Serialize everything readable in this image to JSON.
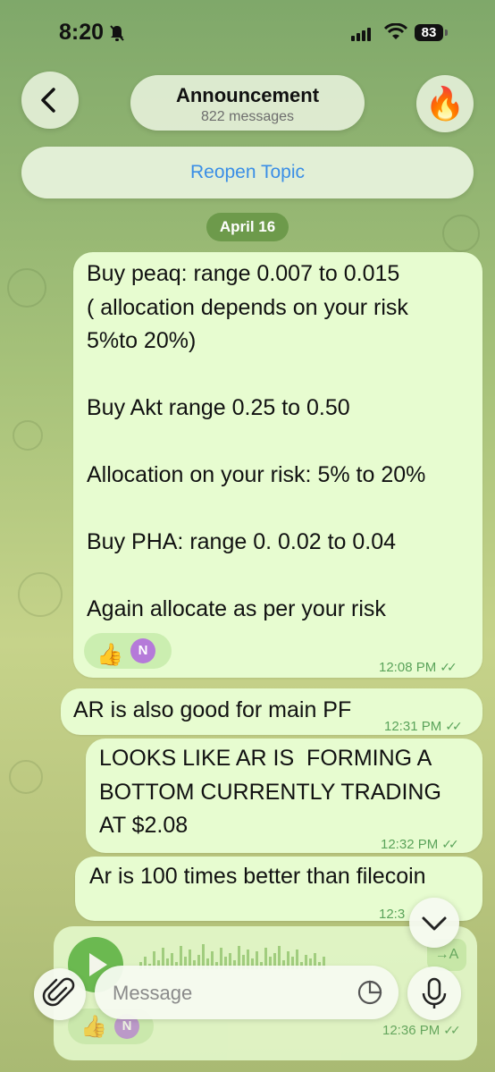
{
  "status_bar": {
    "time": "8:20",
    "battery": "83"
  },
  "header": {
    "title": "Announcement",
    "subtitle": "822 messages",
    "avatar_emoji": "🔥",
    "reopen_label": "Reopen Topic"
  },
  "date_chip": "April 16",
  "messages": [
    {
      "text": "Buy peaq: range 0.007 to 0.015\n( allocation depends on your risk\n5%to 20%)\n\nBuy Akt range 0.25 to 0.50\n\nAllocation on your risk: 5% to 20%\n\nBuy PHA: range 0. 0.02 to 0.04\n\nAgain allocate as per your risk",
      "time": "12:08 PM",
      "reaction_emoji": "👍",
      "reaction_avatar": "N"
    },
    {
      "text": "AR is also good for main PF",
      "time": "12:31 PM"
    },
    {
      "text": "LOOKS LIKE AR IS  FORMING A\nBOTTOM CURRENTLY TRADING\nAT $2.08",
      "time": "12:32 PM"
    },
    {
      "text": "Ar is 100 times better than filecoin",
      "time": "12:3"
    },
    {
      "voice": true,
      "transcribe_label": "→A",
      "time": "12:36 PM",
      "reaction_emoji": "👍",
      "reaction_avatar": "N"
    }
  ],
  "composer": {
    "placeholder": "Message"
  },
  "colors": {
    "bubble": "#e7fcd0",
    "accent": "#3a8ee6",
    "time_green": "#5aa35a",
    "date_chip": "#6d9a4b"
  }
}
